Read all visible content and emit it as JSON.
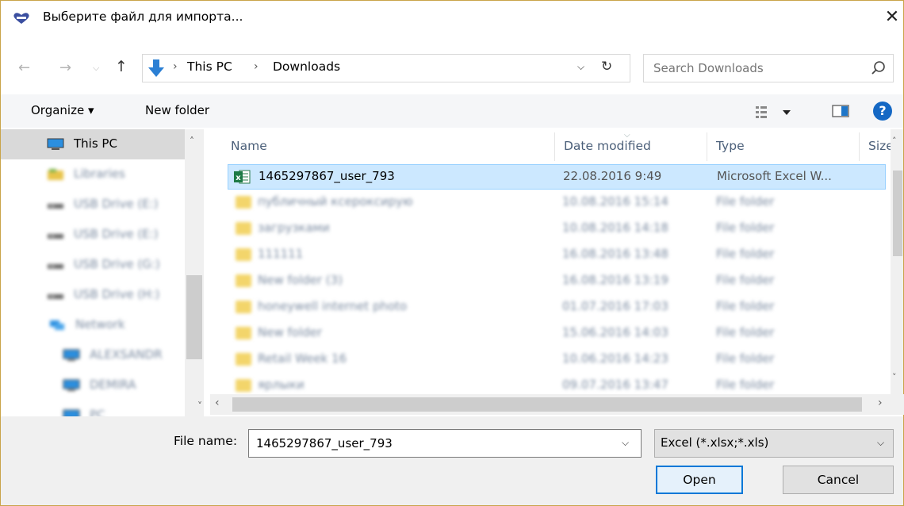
{
  "window": {
    "title": "Выберите файл для импорта...",
    "close_glyph": "✕",
    "border_color": "#c9a44a"
  },
  "nav": {
    "back_glyph": "←",
    "forward_glyph": "→",
    "recent_glyph": "⌵",
    "up_glyph": "↑"
  },
  "address": {
    "separator": "›",
    "crumbs": [
      "This PC",
      "Downloads"
    ],
    "dropdown_glyph": "⌵",
    "refresh_glyph": "↻"
  },
  "search": {
    "placeholder": "Search Downloads",
    "icon": "search-icon"
  },
  "toolbar": {
    "organize_label": "Organize ▾",
    "new_folder_label": "New folder",
    "help_label": "?"
  },
  "navpane": {
    "items": [
      {
        "label": "This PC",
        "icon": "computer-icon",
        "selected": true,
        "blurred": false
      },
      {
        "label": "Libraries",
        "icon": "libraries-icon",
        "selected": false,
        "blurred": true
      },
      {
        "label": "USB Drive (E:)",
        "icon": "usb-drive-icon",
        "selected": false,
        "blurred": true
      },
      {
        "label": "USB Drive (E:)",
        "icon": "usb-drive-icon",
        "selected": false,
        "blurred": true
      },
      {
        "label": "USB Drive (G:)",
        "icon": "usb-drive-icon",
        "selected": false,
        "blurred": true
      },
      {
        "label": "USB Drive (H:)",
        "icon": "usb-drive-icon",
        "selected": false,
        "blurred": true
      },
      {
        "label": "Network",
        "icon": "network-icon",
        "selected": false,
        "blurred": true
      },
      {
        "label": "ALEXSANDR",
        "icon": "computer-icon",
        "selected": false,
        "blurred": true
      },
      {
        "label": "DEMIRA",
        "icon": "computer-icon",
        "selected": false,
        "blurred": true
      },
      {
        "label": "PC",
        "icon": "computer-icon",
        "selected": false,
        "blurred": true
      }
    ],
    "scroll_up_glyph": "˄",
    "scroll_down_glyph": "˅"
  },
  "filelist": {
    "columns": [
      "Name",
      "Date modified",
      "Type",
      "Size"
    ],
    "rows": [
      {
        "name": "1465297867_user_793",
        "date": "22.08.2016 9:49",
        "type": "Microsoft Excel W...",
        "icon": "excel-file-icon",
        "selected": true,
        "blurred": false
      },
      {
        "name": "публичный ксероксирую",
        "date": "10.08.2016 15:14",
        "type": "File folder",
        "icon": "folder-icon",
        "selected": false,
        "blurred": true
      },
      {
        "name": "загрузками",
        "date": "10.08.2016 14:18",
        "type": "File folder",
        "icon": "folder-icon",
        "selected": false,
        "blurred": true
      },
      {
        "name": "111111",
        "date": "16.08.2016 13:48",
        "type": "File folder",
        "icon": "folder-icon",
        "selected": false,
        "blurred": true
      },
      {
        "name": "New folder (3)",
        "date": "16.08.2016 13:19",
        "type": "File folder",
        "icon": "folder-icon",
        "selected": false,
        "blurred": true
      },
      {
        "name": "honeywell internet photo",
        "date": "01.07.2016 17:03",
        "type": "File folder",
        "icon": "folder-icon",
        "selected": false,
        "blurred": true
      },
      {
        "name": "New folder",
        "date": "15.06.2016 14:03",
        "type": "File folder",
        "icon": "folder-icon",
        "selected": false,
        "blurred": true
      },
      {
        "name": "Retail Week 16",
        "date": "10.06.2016 14:23",
        "type": "File folder",
        "icon": "folder-icon",
        "selected": false,
        "blurred": true
      },
      {
        "name": "ярлыки",
        "date": "09.07.2016 13:47",
        "type": "File folder",
        "icon": "folder-icon",
        "selected": false,
        "blurred": true
      }
    ],
    "sort_glyph": "⌵",
    "scroll_up_glyph": "˄",
    "scroll_down_glyph": "˅",
    "scroll_left_glyph": "‹",
    "scroll_right_glyph": "›"
  },
  "bottom": {
    "file_name_label": "File name:",
    "file_name_value": "1465297867_user_793",
    "dropdown_glyph": "⌵",
    "file_type_value": "Excel (*.xlsx;*.xls)",
    "open_label": "Open",
    "cancel_label": "Cancel"
  },
  "colors": {
    "selection_bg": "#cce8ff",
    "selection_border": "#99d1ff",
    "accent": "#0078d7",
    "header_text": "#4c607a"
  }
}
